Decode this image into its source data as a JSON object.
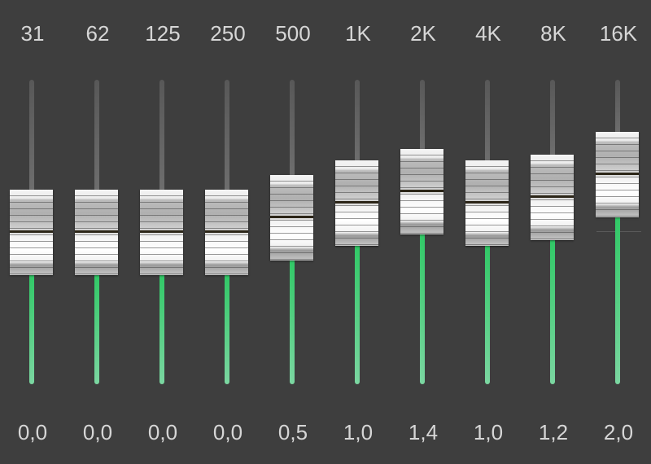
{
  "equalizer": {
    "bands": [
      {
        "frequency": "31",
        "gain_label": "0,0",
        "gain": 0.0
      },
      {
        "frequency": "62",
        "gain_label": "0,0",
        "gain": 0.0
      },
      {
        "frequency": "125",
        "gain_label": "0,0",
        "gain": 0.0
      },
      {
        "frequency": "250",
        "gain_label": "0,0",
        "gain": 0.0
      },
      {
        "frequency": "500",
        "gain_label": "0,5",
        "gain": 0.5
      },
      {
        "frequency": "1K",
        "gain_label": "1,0",
        "gain": 1.0
      },
      {
        "frequency": "2K",
        "gain_label": "1,4",
        "gain": 1.4
      },
      {
        "frequency": "4K",
        "gain_label": "1,0",
        "gain": 1.0
      },
      {
        "frequency": "8K",
        "gain_label": "1,2",
        "gain": 1.2
      },
      {
        "frequency": "16K",
        "gain_label": "2,0",
        "gain": 2.0
      }
    ]
  },
  "colors": {
    "background": "#3e3e3e",
    "label_text": "#d6d6d6",
    "track_upper": "#5f5f5f",
    "track_active": "#3ccf6e",
    "knob": "#e6e6e6",
    "knob_center_line": "#2c2618"
  }
}
